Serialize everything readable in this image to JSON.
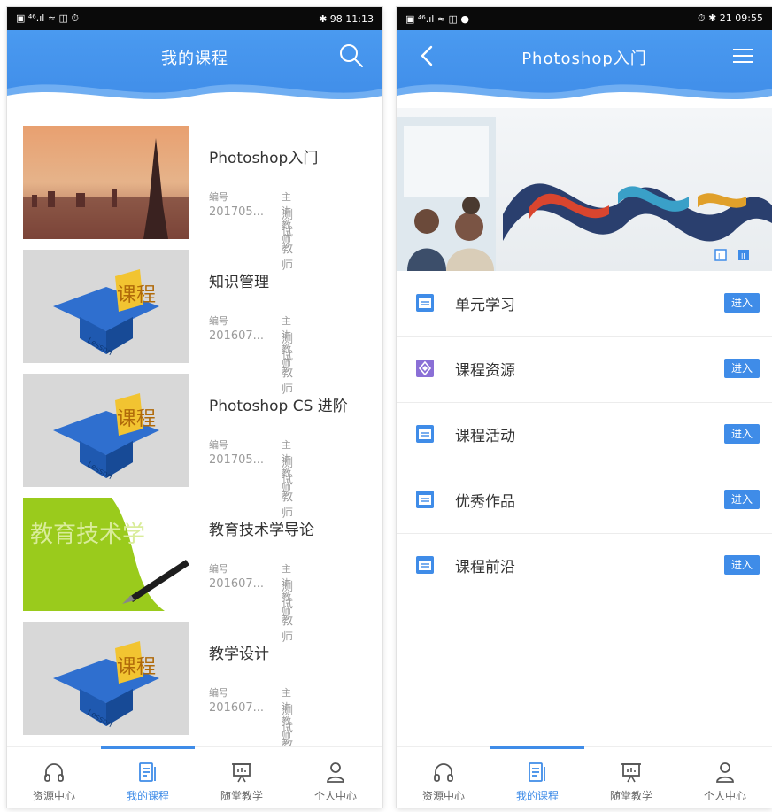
{
  "left": {
    "status": {
      "left_icons": "▣ ⁴⁶.ıl ≈ ◫ ⏱",
      "right_text": "✱ 98 11:13"
    },
    "header": {
      "title": "我的课程"
    },
    "labels": {
      "number_label": "编号",
      "teacher_label": "主讲教师"
    },
    "courses": [
      {
        "name": "Photoshop入门",
        "number": "201705...",
        "teacher": "测试教师",
        "thumb": "city-sunset"
      },
      {
        "name": "知识管理",
        "number": "201607...",
        "teacher": "测试教师",
        "thumb": "lesson-cap"
      },
      {
        "name": "Photoshop CS 进阶",
        "number": "201705...",
        "teacher": "测试教师",
        "thumb": "lesson-cap"
      },
      {
        "name": "教育技术学导论",
        "number": "201607...",
        "teacher": "测试教师",
        "thumb": "edu-tech"
      },
      {
        "name": "教学设计",
        "number": "201607...",
        "teacher": "测试教师",
        "thumb": "lesson-cap"
      }
    ],
    "thumb_texts": {
      "cap_text": "课程",
      "cap_sub": "Lesson",
      "edu_text": "教育技术学"
    },
    "nav": [
      {
        "label": "资源中心",
        "icon": "headphones-icon"
      },
      {
        "label": "我的课程",
        "icon": "book-list-icon",
        "active": true
      },
      {
        "label": "随堂教学",
        "icon": "presentation-board-icon"
      },
      {
        "label": "个人中心",
        "icon": "user-icon"
      }
    ]
  },
  "right": {
    "status": {
      "left_icons": "▣ ⁴⁶.ıl ≈ ◫ ●",
      "right_text": "⏱ ✱ 21 09:55"
    },
    "header": {
      "title": "Photoshop入门"
    },
    "banner_dots": [
      "I",
      "II"
    ],
    "menu": [
      {
        "label": "单元学习",
        "icon": "folder-icon",
        "button": "进入"
      },
      {
        "label": "课程资源",
        "icon": "resource-diamond-icon",
        "button": "进入"
      },
      {
        "label": "课程活动",
        "icon": "folder-icon",
        "button": "进入"
      },
      {
        "label": "优秀作品",
        "icon": "folder-icon",
        "button": "进入"
      },
      {
        "label": "课程前沿",
        "icon": "folder-icon",
        "button": "进入"
      }
    ],
    "nav": [
      {
        "label": "资源中心",
        "icon": "headphones-icon"
      },
      {
        "label": "我的课程",
        "icon": "book-list-icon",
        "active": true
      },
      {
        "label": "随堂教学",
        "icon": "presentation-board-icon"
      },
      {
        "label": "个人中心",
        "icon": "user-icon"
      }
    ]
  },
  "colors": {
    "primary": "#3f8ce8",
    "header_light": "#4a9af0",
    "text": "#333333",
    "muted": "#9a9a9a",
    "resource_purple": "#8a6fd6"
  }
}
